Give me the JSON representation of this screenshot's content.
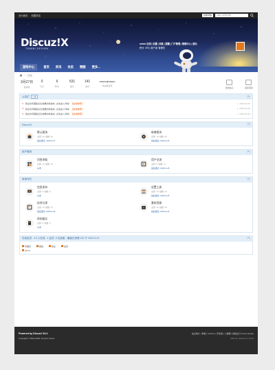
{
  "topbar": {
    "links": [
      "设为首页",
      "收藏本站"
    ],
    "style_switch": "切换风格",
    "search_placeholder": "请输入搜索内容"
  },
  "header": {
    "logo": "Discuz!X",
    "logo_sub": "TEMINI DESIGN",
    "user_line1": "admin  在线 | 设置 | 消息 | 提醒 | 门户管理 | 管理中心 | 退出",
    "user_line2": "积分: 399 | 用户组: 管理员"
  },
  "nav": {
    "items": [
      "游戏中心",
      "首页",
      "资讯",
      "会员",
      "晒图",
      "更多..."
    ]
  },
  "breadcrumb": {
    "home": "",
    "current": "论坛"
  },
  "stats": [
    {
      "n": "3月27日",
      "t": "最新帖"
    },
    {
      "n": "0",
      "t": "今日"
    },
    {
      "n": "6",
      "t": "昨日"
    },
    {
      "n": "531",
      "t": "帖子"
    },
    {
      "n": "141",
      "t": "会员"
    }
  ],
  "newest_member": {
    "n": "memojinamu",
    "t": "欢迎新会员"
  },
  "quick": [
    {
      "t": "我的帖子"
    },
    {
      "t": "最新回复"
    }
  ],
  "notice": {
    "title": "公告栏",
    "tag": "公告",
    "rows": [
      {
        "text": "欢迎访问模板论坛效果的新版本, 点击进入详情!",
        "hl": "【最新推荐】",
        "date": "2020-03-29"
      },
      {
        "text": "欢迎访问模板论坛效果的新版本, 点击进入详情!",
        "hl": "【最新推荐】",
        "date": "2020-03-29"
      },
      {
        "text": "欢迎访问模板论坛效果的新版本, 点击进入详情!",
        "hl": "【最新推荐】",
        "date": "2020-03-29"
      }
    ]
  },
  "sections": [
    {
      "title": "Discuz!X",
      "forums": [
        {
          "name": "默认版块",
          "stats": "主题: 25, 帖数: 46",
          "last": "最后发表: 2020-3-27"
        },
        {
          "name": "新增版块",
          "stats": "主题: 19, 帖数: 26",
          "last": "最后发表: 2020-3-26"
        }
      ]
    },
    {
      "title": "用户服务",
      "forums": [
        {
          "name": "问答求助",
          "stats": "主题: 12, 帖数: 18",
          "last": "从未"
        },
        {
          "name": "用户交流",
          "stats": "主题: 8, 帖数: 11",
          "last": "最后发表: 2020-3-26"
        }
      ]
    },
    {
      "title": "其他专栏",
      "forums": [
        {
          "name": "信息发布",
          "stats": "主题: 9, 帖数: 9",
          "last": "从未"
        },
        {
          "name": "设置工具",
          "stats": "主题: 14, 帖数: 16",
          "last": "最后发表: 2020-3-25"
        },
        {
          "name": "技术分享",
          "stats": "主题: 13, 帖数: 14",
          "last": "最后发表: 2020-3-24"
        },
        {
          "name": "素材资源",
          "stats": "主题: 10, 帖数: 19",
          "last": "最后发表: 2020-3-24"
        },
        {
          "name": "休闲娱乐",
          "stats": "主题: 6, 帖数: 6",
          "last": "从未"
        }
      ]
    }
  ],
  "online": {
    "title": "在线会员 - 10 人在线 - 1 会员, 9 位游客 - 最高记录是 119 于 2020-3-21",
    "users": [
      "管理员",
      "超版",
      "版主",
      "会员"
    ],
    "me": "admin"
  },
  "footer": {
    "powered": "Powered by Discuz! X3.4",
    "copyright": "Copyright © 2001-2020, Tencent Cloud.",
    "links": "站点统计 | 举报 | Archiver | 手机版 | 小黑屋 | 模板设计 Temini Studio",
    "gmt": "GMT+8, 2020-3-27 12:24"
  }
}
